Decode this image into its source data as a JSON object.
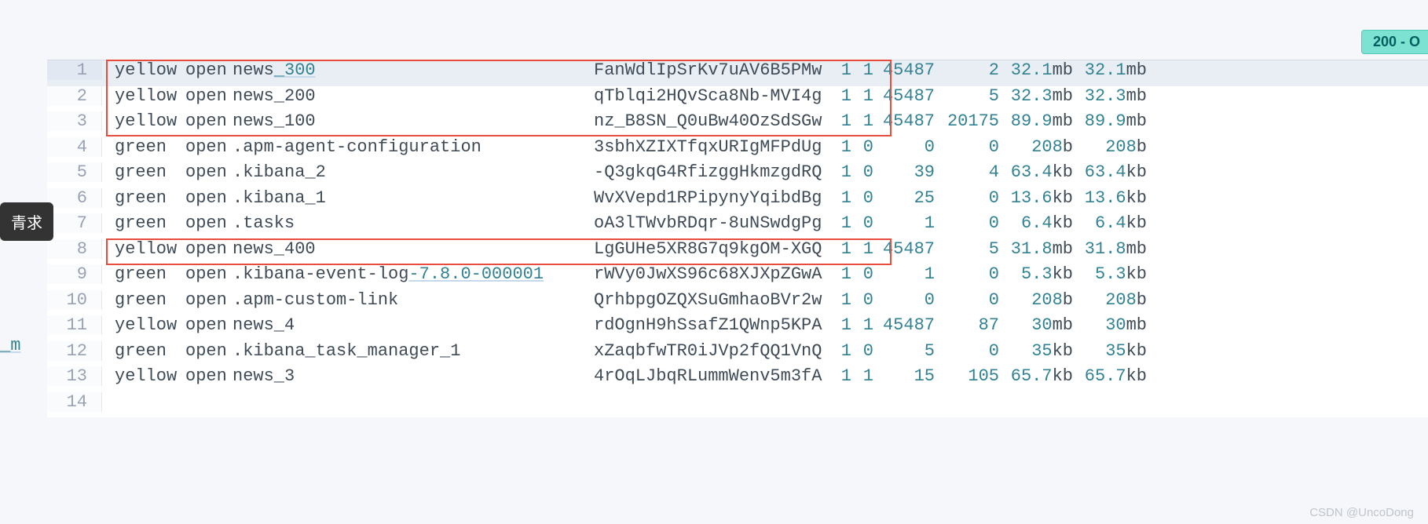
{
  "tooltip": {
    "label": "青求"
  },
  "status_badge": {
    "label": "200 - O"
  },
  "left_fragment": "_m",
  "watermark": "CSDN @UncoDong",
  "rows": [
    {
      "n": "1",
      "health": "yellow",
      "status": "open",
      "index_pre": "news",
      "index_link": "_300",
      "index_post": "",
      "uuid": "FanWdlIpSrKv7uAV6B5PMw",
      "pri": "1",
      "rep": "1",
      "docs": "45487",
      "del": "2",
      "ss_n": "32.1",
      "ss_u": "mb",
      "ps_n": "32.1",
      "ps_u": "mb",
      "active": true
    },
    {
      "n": "2",
      "health": "yellow",
      "status": "open",
      "index_pre": "news_200",
      "index_link": "",
      "index_post": "",
      "uuid": "qTblqi2HQvSca8Nb-MVI4g",
      "pri": "1",
      "rep": "1",
      "docs": "45487",
      "del": "5",
      "ss_n": "32.3",
      "ss_u": "mb",
      "ps_n": "32.3",
      "ps_u": "mb"
    },
    {
      "n": "3",
      "health": "yellow",
      "status": "open",
      "index_pre": "news_100",
      "index_link": "",
      "index_post": "",
      "uuid": "nz_B8SN_Q0uBw40OzSdSGw",
      "pri": "1",
      "rep": "1",
      "docs": "45487",
      "del": "20175",
      "ss_n": "89.9",
      "ss_u": "mb",
      "ps_n": "89.9",
      "ps_u": "mb"
    },
    {
      "n": "4",
      "health": "green",
      "status": "open",
      "index_pre": ".apm-agent-configuration",
      "index_link": "",
      "index_post": "",
      "uuid": "3sbhXZIXTfqxURIgMFPdUg",
      "pri": "1",
      "rep": "0",
      "docs": "0",
      "del": "0",
      "ss_n": "208",
      "ss_u": "b",
      "ps_n": "208",
      "ps_u": "b"
    },
    {
      "n": "5",
      "health": "green",
      "status": "open",
      "index_pre": ".kibana_2",
      "index_link": "",
      "index_post": "",
      "uuid": "-Q3gkqG4RfizggHkmzgdRQ",
      "pri": "1",
      "rep": "0",
      "docs": "39",
      "del": "4",
      "ss_n": "63.4",
      "ss_u": "kb",
      "ps_n": "63.4",
      "ps_u": "kb"
    },
    {
      "n": "6",
      "health": "green",
      "status": "open",
      "index_pre": ".kibana_1",
      "index_link": "",
      "index_post": "",
      "uuid": "WvXVepd1RPipynyYqibdBg",
      "pri": "1",
      "rep": "0",
      "docs": "25",
      "del": "0",
      "ss_n": "13.6",
      "ss_u": "kb",
      "ps_n": "13.6",
      "ps_u": "kb"
    },
    {
      "n": "7",
      "health": "green",
      "status": "open",
      "index_pre": ".tasks",
      "index_link": "",
      "index_post": "",
      "uuid": "oA3lTWvbRDqr-8uNSwdgPg",
      "pri": "1",
      "rep": "0",
      "docs": "1",
      "del": "0",
      "ss_n": "6.4",
      "ss_u": "kb",
      "ps_n": "6.4",
      "ps_u": "kb"
    },
    {
      "n": "8",
      "health": "yellow",
      "status": "open",
      "index_pre": "news_400",
      "index_link": "",
      "index_post": "",
      "uuid": "LgGUHe5XR8G7q9kgOM-XGQ",
      "pri": "1",
      "rep": "1",
      "docs": "45487",
      "del": "5",
      "ss_n": "31.8",
      "ss_u": "mb",
      "ps_n": "31.8",
      "ps_u": "mb"
    },
    {
      "n": "9",
      "health": "green",
      "status": "open",
      "index_pre": ".kibana-event-log",
      "index_link": "-7.8.0-000001",
      "index_post": "",
      "uuid": "rWVy0JwXS96c68XJXpZGwA",
      "pri": "1",
      "rep": "0",
      "docs": "1",
      "del": "0",
      "ss_n": "5.3",
      "ss_u": "kb",
      "ps_n": "5.3",
      "ps_u": "kb"
    },
    {
      "n": "10",
      "health": "green",
      "status": "open",
      "index_pre": ".apm-custom-link",
      "index_link": "",
      "index_post": "",
      "uuid": "QrhbpgOZQXSuGmhaoBVr2w",
      "pri": "1",
      "rep": "0",
      "docs": "0",
      "del": "0",
      "ss_n": "208",
      "ss_u": "b",
      "ps_n": "208",
      "ps_u": "b"
    },
    {
      "n": "11",
      "health": "yellow",
      "status": "open",
      "index_pre": "news_4",
      "index_link": "",
      "index_post": "",
      "uuid": "rdOgnH9hSsafZ1QWnp5KPA",
      "pri": "1",
      "rep": "1",
      "docs": "45487",
      "del": "87",
      "ss_n": "30",
      "ss_u": "mb",
      "ps_n": "30",
      "ps_u": "mb"
    },
    {
      "n": "12",
      "health": "green",
      "status": "open",
      "index_pre": ".kibana_task_manager_1",
      "index_link": "",
      "index_post": "",
      "uuid": "xZaqbfwTR0iJVp2fQQ1VnQ",
      "pri": "1",
      "rep": "0",
      "docs": "5",
      "del": "0",
      "ss_n": "35",
      "ss_u": "kb",
      "ps_n": "35",
      "ps_u": "kb"
    },
    {
      "n": "13",
      "health": "yellow",
      "status": "open",
      "index_pre": "news_3",
      "index_link": "",
      "index_post": "",
      "uuid": "4rOqLJbqRLummWenv5m3fA",
      "pri": "1",
      "rep": "1",
      "docs": "15",
      "del": "105",
      "ss_n": "65.7",
      "ss_u": "kb",
      "ps_n": "65.7",
      "ps_u": "kb"
    },
    {
      "n": "14",
      "empty": true
    }
  ]
}
